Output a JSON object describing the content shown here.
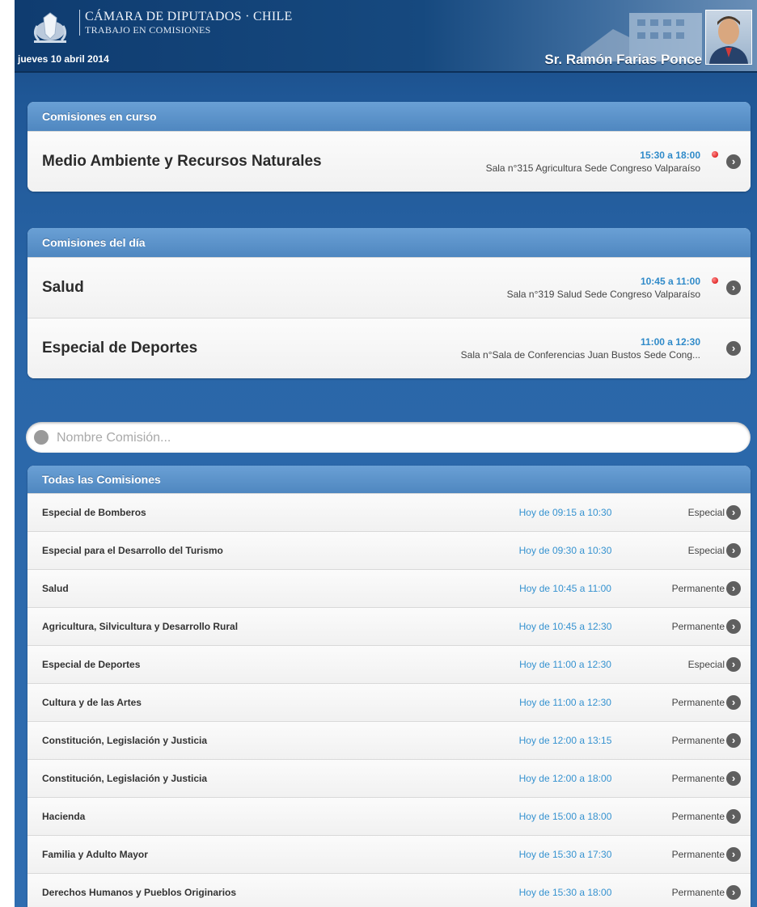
{
  "header": {
    "org_name": "CÁMARA DE DIPUTADOS · CHILE",
    "org_sub": "TRABAJO EN COMISIONES",
    "date": "jueves 10 abril 2014",
    "user_name": "Sr. Ramón Farias Ponce"
  },
  "en_curso": {
    "header": "Comisiones en curso",
    "items": [
      {
        "title": "Medio Ambiente y Recursos Naturales",
        "time": "15:30 a 18:00",
        "place": "Sala n°315 Agricultura Sede Congreso Valparaíso"
      }
    ]
  },
  "del_dia": {
    "header": "Comisiones del día",
    "items": [
      {
        "title": "Salud",
        "time": "10:45 a 11:00",
        "place": "Sala n°319 Salud Sede Congreso Valparaíso"
      },
      {
        "title": "Especial de Deportes",
        "time": "11:00 a 12:30",
        "place": "Sala n°Sala de Conferencias Juan Bustos Sede Cong..."
      }
    ]
  },
  "search": {
    "placeholder": "Nombre Comisión..."
  },
  "todas": {
    "header": "Todas las Comisiones",
    "items": [
      {
        "name": "Especial de Bomberos",
        "time": "Hoy de 09:15 a 10:30",
        "type": "Especial"
      },
      {
        "name": "Especial para el Desarrollo del Turismo",
        "time": "Hoy de 09:30 a 10:30",
        "type": "Especial"
      },
      {
        "name": "Salud",
        "time": "Hoy de 10:45 a 11:00",
        "type": "Permanente"
      },
      {
        "name": "Agricultura, Silvicultura y Desarrollo Rural",
        "time": "Hoy de 10:45 a 12:30",
        "type": "Permanente"
      },
      {
        "name": "Especial de Deportes",
        "time": "Hoy de 11:00 a 12:30",
        "type": "Especial"
      },
      {
        "name": "Cultura y de las Artes",
        "time": "Hoy de 11:00 a 12:30",
        "type": "Permanente"
      },
      {
        "name": "Constitución, Legislación y Justicia",
        "time": "Hoy de 12:00 a 13:15",
        "type": "Permanente"
      },
      {
        "name": "Constitución, Legislación y Justicia",
        "time": "Hoy de 12:00 a 18:00",
        "type": "Permanente"
      },
      {
        "name": "Hacienda",
        "time": "Hoy de 15:00 a 18:00",
        "type": "Permanente"
      },
      {
        "name": "Familia y Adulto Mayor",
        "time": "Hoy de 15:30 a 17:30",
        "type": "Permanente"
      },
      {
        "name": "Derechos Humanos y Pueblos Originarios",
        "time": "Hoy de 15:30 a 18:00",
        "type": "Permanente"
      }
    ]
  }
}
